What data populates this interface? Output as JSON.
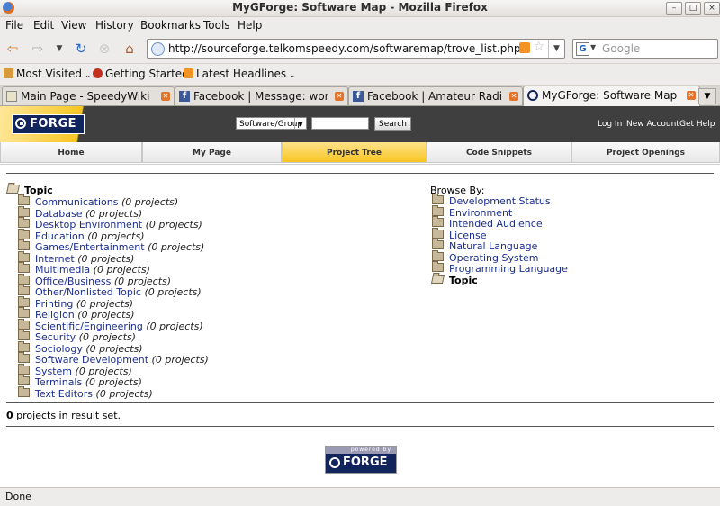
{
  "window": {
    "title": "MyGForge: Software Map - Mozilla Firefox"
  },
  "menu": [
    "File",
    "Edit",
    "View",
    "History",
    "Bookmarks",
    "Tools",
    "Help"
  ],
  "url": "http://sourceforge.telkomspeedy.com/softwaremap/trove_list.php",
  "search_placeholder": "Google",
  "bookmarks": [
    "Most Visited",
    "Getting Started",
    "Latest Headlines"
  ],
  "tabs": [
    {
      "label": "Main Page - SpeedyWiki",
      "icon": "wiki-icon"
    },
    {
      "label": "Facebook | Message: works...",
      "icon": "facebook-icon"
    },
    {
      "label": "Facebook | Amateur Radio",
      "icon": "facebook-icon"
    },
    {
      "label": "MyGForge: Software Map",
      "icon": "gforge-icon"
    }
  ],
  "site": {
    "logo": "FORGE",
    "search_select": "Software/Group",
    "search_button": "Search",
    "links": [
      "Log In",
      "New Account",
      "Get Help"
    ],
    "nav": [
      "Home",
      "My Page",
      "Project Tree",
      "Code Snippets",
      "Project Openings"
    ]
  },
  "topic_heading": "Topic",
  "categories": [
    {
      "name": "Communications",
      "count": "(0 projects)"
    },
    {
      "name": "Database",
      "count": "(0 projects)"
    },
    {
      "name": "Desktop Environment",
      "count": "(0 projects)"
    },
    {
      "name": "Education",
      "count": "(0 projects)"
    },
    {
      "name": "Games/Entertainment",
      "count": "(0 projects)"
    },
    {
      "name": "Internet",
      "count": "(0 projects)"
    },
    {
      "name": "Multimedia",
      "count": "(0 projects)"
    },
    {
      "name": "Office/Business",
      "count": "(0 projects)"
    },
    {
      "name": "Other/Nonlisted Topic",
      "count": "(0 projects)"
    },
    {
      "name": "Printing",
      "count": "(0 projects)"
    },
    {
      "name": "Religion",
      "count": "(0 projects)"
    },
    {
      "name": "Scientific/Engineering",
      "count": "(0 projects)"
    },
    {
      "name": "Security",
      "count": "(0 projects)"
    },
    {
      "name": "Sociology",
      "count": "(0 projects)"
    },
    {
      "name": "Software Development",
      "count": "(0 projects)"
    },
    {
      "name": "System",
      "count": "(0 projects)"
    },
    {
      "name": "Terminals",
      "count": "(0 projects)"
    },
    {
      "name": "Text Editors",
      "count": "(0 projects)"
    }
  ],
  "browse_by": {
    "heading": "Browse By:",
    "items": [
      "Development Status",
      "Environment",
      "Intended Audience",
      "License",
      "Natural Language",
      "Operating System",
      "Programming Language"
    ],
    "current": "Topic"
  },
  "result": {
    "count": "0",
    "text": " projects in result set."
  },
  "powered": {
    "top": "powered by",
    "logo": "FORGE"
  },
  "status": "Done"
}
